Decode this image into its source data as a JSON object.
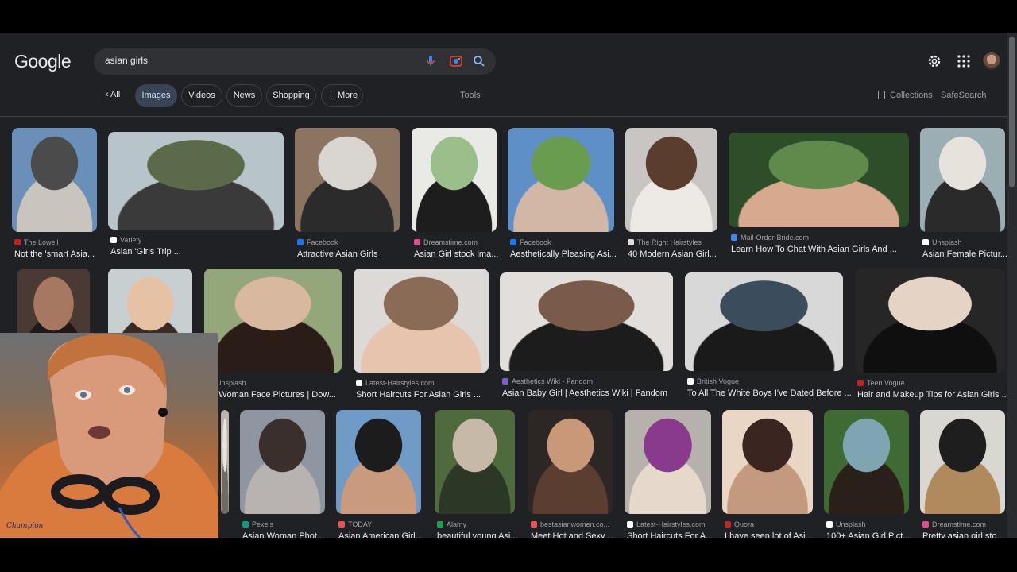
{
  "logo": "Google",
  "search": {
    "query": "asian girls"
  },
  "tabs": [
    {
      "label": "All"
    },
    {
      "label": "Images"
    },
    {
      "label": "Videos"
    },
    {
      "label": "News"
    },
    {
      "label": "Shopping"
    },
    {
      "label": "More"
    }
  ],
  "tools_label": "Tools",
  "collections_label": "Collections",
  "safesearch_label": "SafeSearch",
  "accent": "#8ab4f8",
  "results": [
    {
      "source": "The Lowell",
      "title": "Not the 'smart Asia...",
      "fav": "#c5221f",
      "img": [
        "#6a8fb8",
        "#4b4b4b",
        "#c9c5bd"
      ]
    },
    {
      "source": "Variety",
      "title": "Asian 'Girls Trip ...",
      "fav": "#ffffff",
      "img": [
        "#b7c4c9",
        "#5b6b4a",
        "#3a3a3a"
      ]
    },
    {
      "source": "Facebook",
      "title": "Attractive Asian Girls",
      "fav": "#1877f2",
      "img": [
        "#8b7561",
        "#d9d6d1",
        "#2b2b2b"
      ]
    },
    {
      "source": "Dreamstime.com",
      "title": "Asian Girl stock ima...",
      "fav": "#e04b8a",
      "img": [
        "#e9e9e6",
        "#9bbf8a",
        "#1d1d1d"
      ]
    },
    {
      "source": "Facebook",
      "title": "Aesthetically Pleasing Asi...",
      "fav": "#1877f2",
      "img": [
        "#5e8fc7",
        "#6a9c4f",
        "#d1b7a4"
      ]
    },
    {
      "source": "The Right Hairstyles",
      "title": "40 Modern Asian Girl...",
      "fav": "#e0dcd6",
      "img": [
        "#c8c5c2",
        "#5a3d2c",
        "#ede9e4"
      ]
    },
    {
      "source": "Mail-Order-Bride.com",
      "title": "Learn How To Chat With Asian Girls And ...",
      "fav": "#4285f4",
      "img": [
        "#2e4e2a",
        "#5f8a4c",
        "#d7a98e"
      ]
    },
    {
      "source": "Unsplash",
      "title": "Asian Female Pictur...",
      "fav": "#ffffff",
      "img": [
        "#9aaeb3",
        "#e7e3dc",
        "#2a2a2a"
      ]
    },
    {
      "source": "",
      "title": "",
      "fav": "#9aa0a6",
      "img": [
        "#4a3a33",
        "#a67862",
        "#1f1816"
      ]
    },
    {
      "source": "",
      "title": "",
      "fav": "#9aa0a6",
      "img": [
        "#c7cfd1",
        "#e6c1a4",
        "#3b2b22"
      ]
    },
    {
      "source": "Unsplash",
      "title": "an Woman Face Pictures | Dow...",
      "fav": "#ffffff",
      "img": [
        "#93a77a",
        "#d9b8a0",
        "#2a1d17"
      ]
    },
    {
      "source": "Latest-Hairstyles.com",
      "title": "Short Haircuts For Asian Girls ...",
      "fav": "#ffffff",
      "img": [
        "#dcd9d6",
        "#8a6b55",
        "#e6c4ad"
      ]
    },
    {
      "source": "Aesthetics Wiki - Fandom",
      "title": "Asian Baby Girl | Aesthetics Wiki | Fandom",
      "fav": "#7b5ecc",
      "img": [
        "#e1dedb",
        "#7a5a48",
        "#1c1c1c"
      ]
    },
    {
      "source": "British Vogue",
      "title": "To All The White Boys I've Dated Before ...",
      "fav": "#ffffff",
      "img": [
        "#d8d8d8",
        "#3b4d5c",
        "#1a1a1a"
      ]
    },
    {
      "source": "Teen Vogue",
      "title": "Hair and Makeup Tips for Asian Girls ...",
      "fav": "#c5221f",
      "img": [
        "#262626",
        "#e5d3c6",
        "#0f0f0f"
      ]
    },
    {
      "source": "",
      "title": "",
      "fav": "#9aa0a6",
      "img": [
        "#b9b4ad",
        "#e8e4de",
        "#6e6a64"
      ]
    },
    {
      "source": "Pexels",
      "title": "Asian Woman Phot...",
      "fav": "#05a081",
      "img": [
        "#8e96a1",
        "#3a2f2a",
        "#b8b3b0"
      ]
    },
    {
      "source": "TODAY",
      "title": "Asian American Girl...",
      "fav": "#e8534f",
      "img": [
        "#6f9bc6",
        "#1c1c1c",
        "#c99a7c"
      ]
    },
    {
      "source": "Alamy",
      "title": "beautiful young Asi...",
      "fav": "#1ba24a",
      "img": [
        "#4f6a3c",
        "#c6b9a7",
        "#2b3826"
      ]
    },
    {
      "source": "bestasianwomen.co...",
      "title": "Meet Hot and Sexy ...",
      "fav": "#e8534f",
      "img": [
        "#2c2725",
        "#c89878",
        "#5b3e2f"
      ]
    },
    {
      "source": "Latest-Hairstyles.com",
      "title": "Short Haircuts For A...",
      "fav": "#ffffff",
      "img": [
        "#b7b1ab",
        "#8a3a8c",
        "#e7d8cc"
      ]
    },
    {
      "source": "Quora",
      "title": "I have seen lot of Asi...",
      "fav": "#b92b27",
      "img": [
        "#e9d6c4",
        "#3a2520",
        "#c49a7f"
      ]
    },
    {
      "source": "Unsplash",
      "title": "100+ Asian Girl Pict...",
      "fav": "#ffffff",
      "img": [
        "#3f6a34",
        "#7fa4b2",
        "#2b1f1a"
      ]
    },
    {
      "source": "Dreamstime.com",
      "title": "Pretty asian girl sto...",
      "fav": "#e04b8a",
      "img": [
        "#d8d8d0",
        "#1e1e1e",
        "#b08a5c"
      ]
    }
  ],
  "webcam": {
    "shirt_text": "Champion"
  }
}
